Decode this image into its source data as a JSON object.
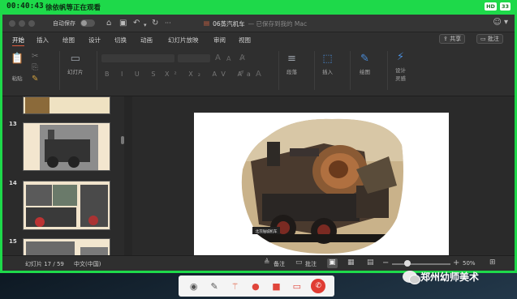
{
  "recorder": {
    "time": "00:40:43",
    "status_text": "徐依帆等正在观看",
    "badges": [
      "HD",
      "33"
    ]
  },
  "window": {
    "autosave_label": "自动保存",
    "doc_name": "06蒸汽机车",
    "saved_status": "— 已保存到我的 Mac"
  },
  "ribbon": {
    "tabs": [
      "开始",
      "插入",
      "绘图",
      "设计",
      "切换",
      "动画",
      "幻灯片放映",
      "审阅",
      "视图"
    ],
    "share_label": "共享",
    "comment_label": "批注"
  },
  "toolbar": {
    "paste_label": "粘贴",
    "slide_label": "幻灯片",
    "paragraph_label": "段落",
    "insert_label": "插入",
    "draw_label": "绘图",
    "design_label": "设计\n灵感"
  },
  "thumbnails": [
    {
      "number": "13"
    },
    {
      "number": "14"
    },
    {
      "number": "15"
    }
  ],
  "slide": {
    "caption": "北京陆城机车"
  },
  "statusbar": {
    "slide_counter": "幻灯片 17 / 59",
    "language": "中文(中国)",
    "notes_label": "备注",
    "comments_label": "批注",
    "zoom": "50%"
  },
  "watermark": {
    "text": "郑州幼师美术"
  },
  "colors": {
    "frame_green": "#1ed94a",
    "accent_tab": "#e05a3b",
    "hangup_red": "#e03c33"
  }
}
